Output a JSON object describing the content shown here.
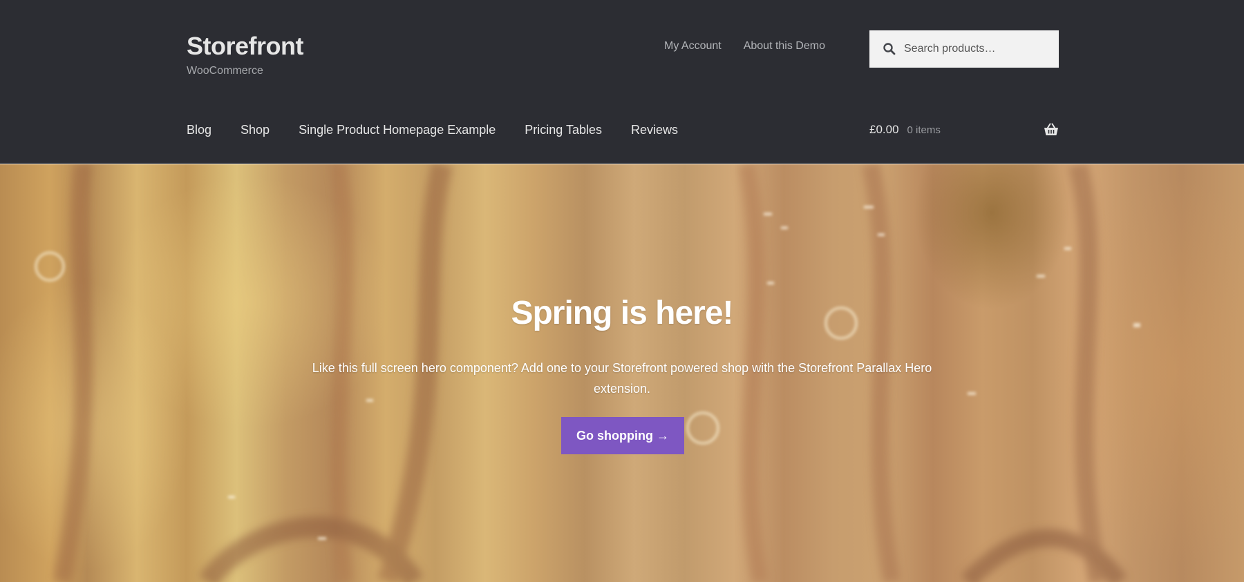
{
  "header": {
    "site_title": "Storefront",
    "tagline": "WooCommerce",
    "secondary_nav": [
      {
        "label": "My Account"
      },
      {
        "label": "About this Demo"
      }
    ],
    "search": {
      "placeholder": "Search products…"
    },
    "primary_nav": [
      {
        "label": "Blog"
      },
      {
        "label": "Shop"
      },
      {
        "label": "Single Product Homepage Example"
      },
      {
        "label": "Pricing Tables"
      },
      {
        "label": "Reviews"
      }
    ],
    "cart": {
      "amount": "£0.00",
      "count": "0 items"
    }
  },
  "hero": {
    "title": "Spring is here!",
    "text": "Like this full screen hero component? Add one to your Storefront powered shop with the Storefront Parallax Hero extension.",
    "button_label": "Go shopping →"
  },
  "colors": {
    "header_bg": "#2c2d33",
    "accent_button": "#7e57c2",
    "search_bg": "#f2f2f2"
  },
  "icons": {
    "search": "search-icon",
    "cart": "basket-icon"
  }
}
